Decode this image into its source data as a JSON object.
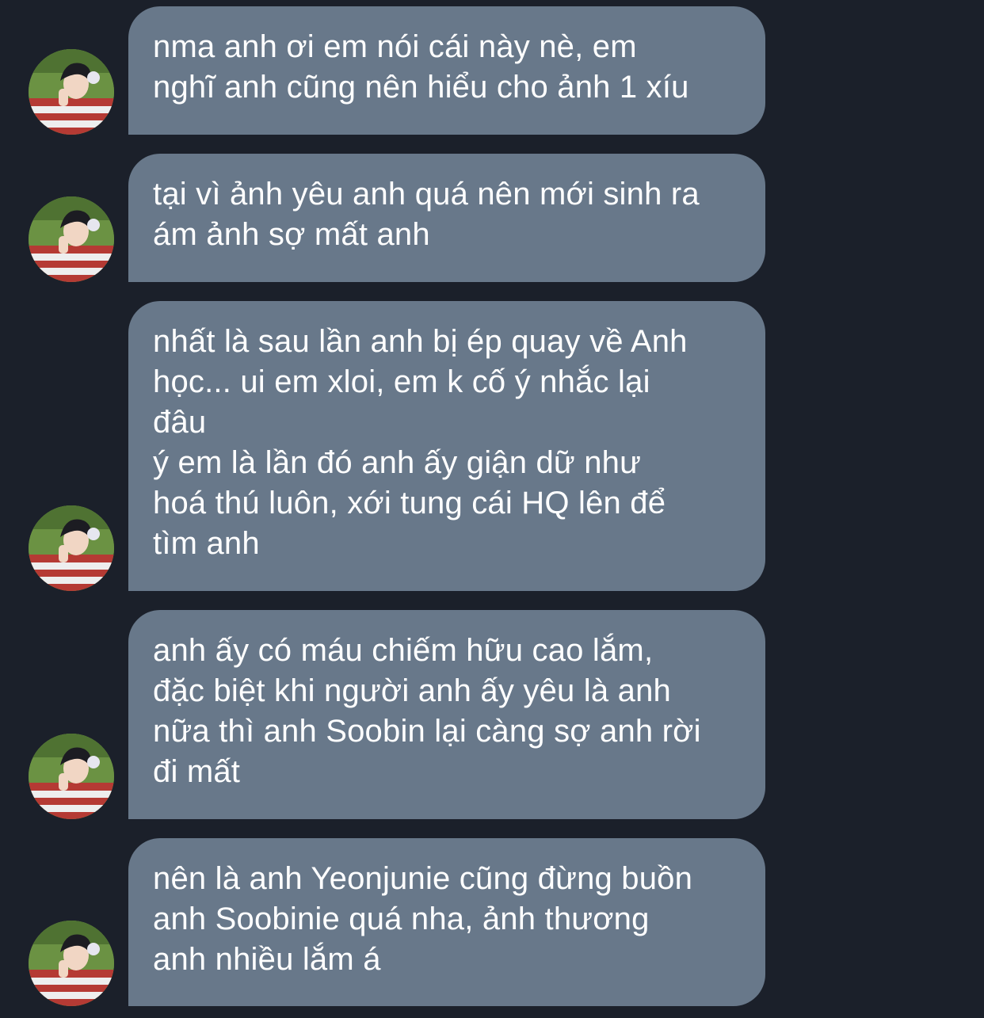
{
  "messages": [
    {
      "text": "nma anh ơi em nói cái này nè, em\nnghĩ anh cũng nên hiểu cho ảnh 1 xíu"
    },
    {
      "text": "tại vì ảnh yêu anh quá nên mới sinh ra\nám ảnh sợ mất anh"
    },
    {
      "text": "nhất là sau lần anh bị ép quay về Anh\nhọc... ui em xloi, em k cố ý nhắc lại\nđâu\ný em là lần đó anh ấy giận dữ như\nhoá thú luôn, xới tung cái HQ lên để\ntìm anh"
    },
    {
      "text": "anh ấy có máu chiếm hữu cao lắm,\nđặc biệt khi người anh ấy yêu là anh\nnữa thì anh Soobin lại càng sợ anh rời\nđi mất"
    },
    {
      "text": "nên là anh Yeonjunie cũng đừng buồn\nanh Soobinie quá nha, ảnh thương\nanh nhiều lắm á"
    }
  ],
  "colors": {
    "background": "#1b202a",
    "bubble": "#68788a",
    "text": "#ffffff"
  },
  "icons": {
    "avatar": "sender-avatar-photo"
  }
}
